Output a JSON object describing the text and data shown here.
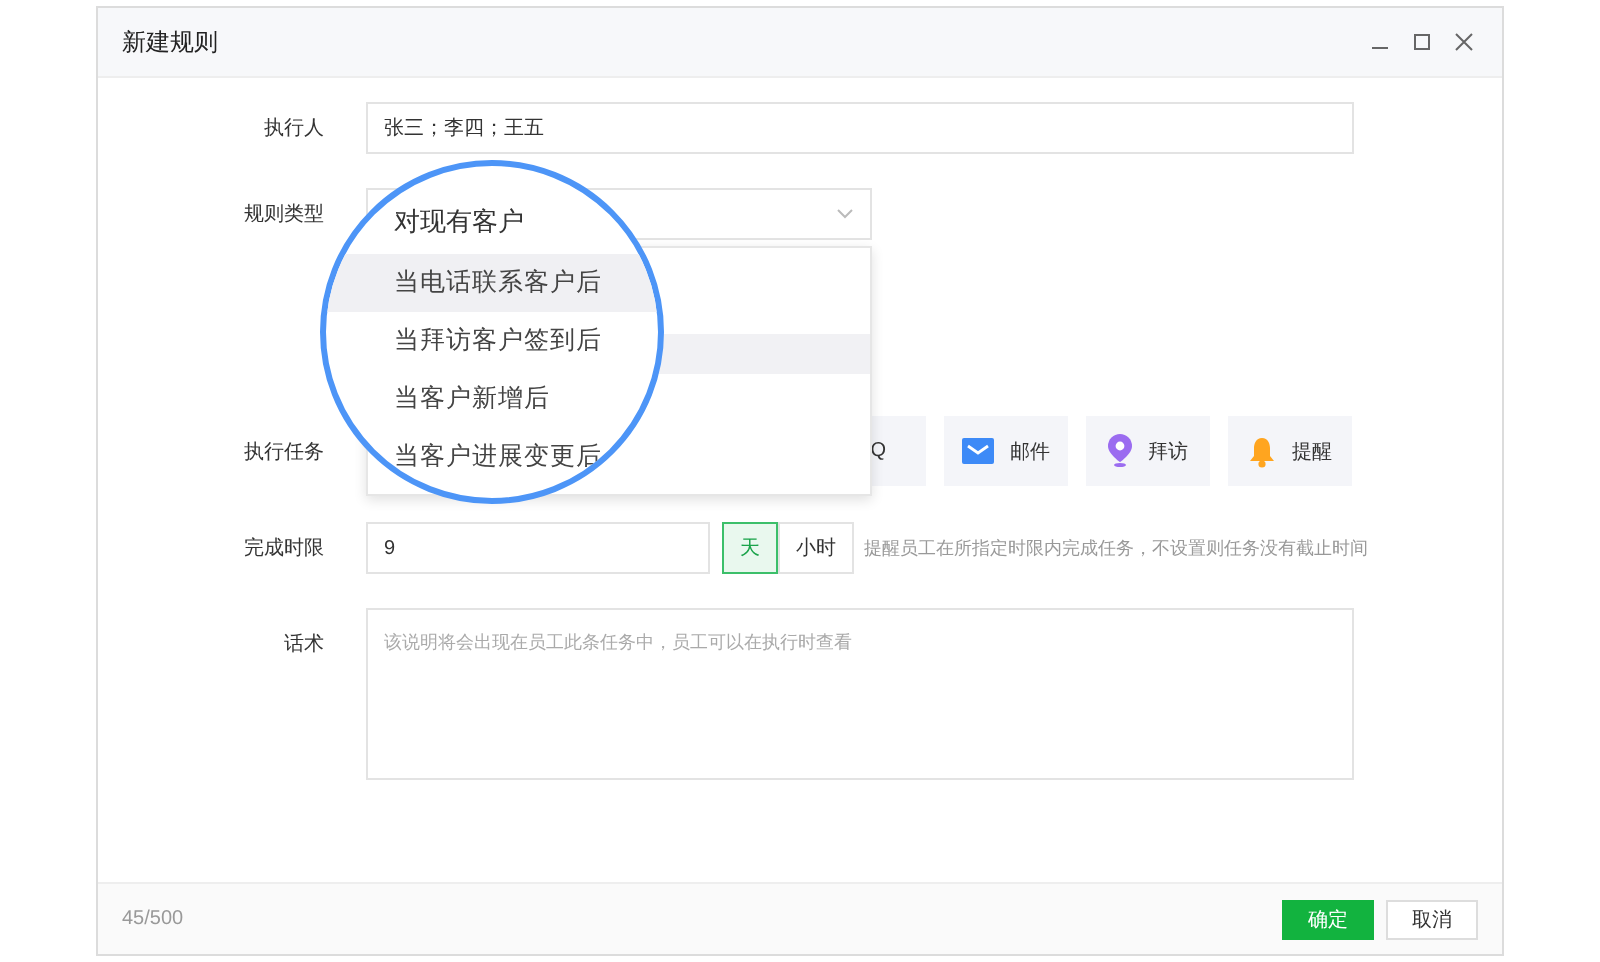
{
  "window": {
    "title": "新建规则"
  },
  "form": {
    "executor_label": "执行人",
    "executor_value": "张三；李四；王五",
    "rule_type_label": "规则类型",
    "task_label": "执行任务",
    "tasks": [
      {
        "kind": "qq",
        "label": "Q"
      },
      {
        "kind": "mail",
        "label": "邮件"
      },
      {
        "kind": "visit",
        "label": "拜访"
      },
      {
        "kind": "remind",
        "label": "提醒"
      }
    ],
    "deadline_label": "完成时限",
    "deadline_value": "9",
    "units": [
      {
        "label": "天",
        "selected": true
      },
      {
        "label": "小时",
        "selected": false
      }
    ],
    "deadline_hint": "提醒员工在所指定时限内完成任务，不设置则任务没有截止时间",
    "script_label": "话术",
    "script_placeholder": "该说明将会出现在员工此条任务中，员工可以在执行时查看"
  },
  "magnifier": {
    "select_value": "对现有客户",
    "options": [
      {
        "label": "当电话联系客户后",
        "highlighted": true
      },
      {
        "label": "当拜访客户签到后",
        "highlighted": false
      },
      {
        "label": "当客户新增后",
        "highlighted": false
      },
      {
        "label": "当客户进展变更后",
        "highlighted": false
      }
    ]
  },
  "footer": {
    "counter": "45/500",
    "buttons": [
      {
        "label": "确定",
        "kind": "primary"
      },
      {
        "label": "取消",
        "kind": "default"
      }
    ]
  }
}
